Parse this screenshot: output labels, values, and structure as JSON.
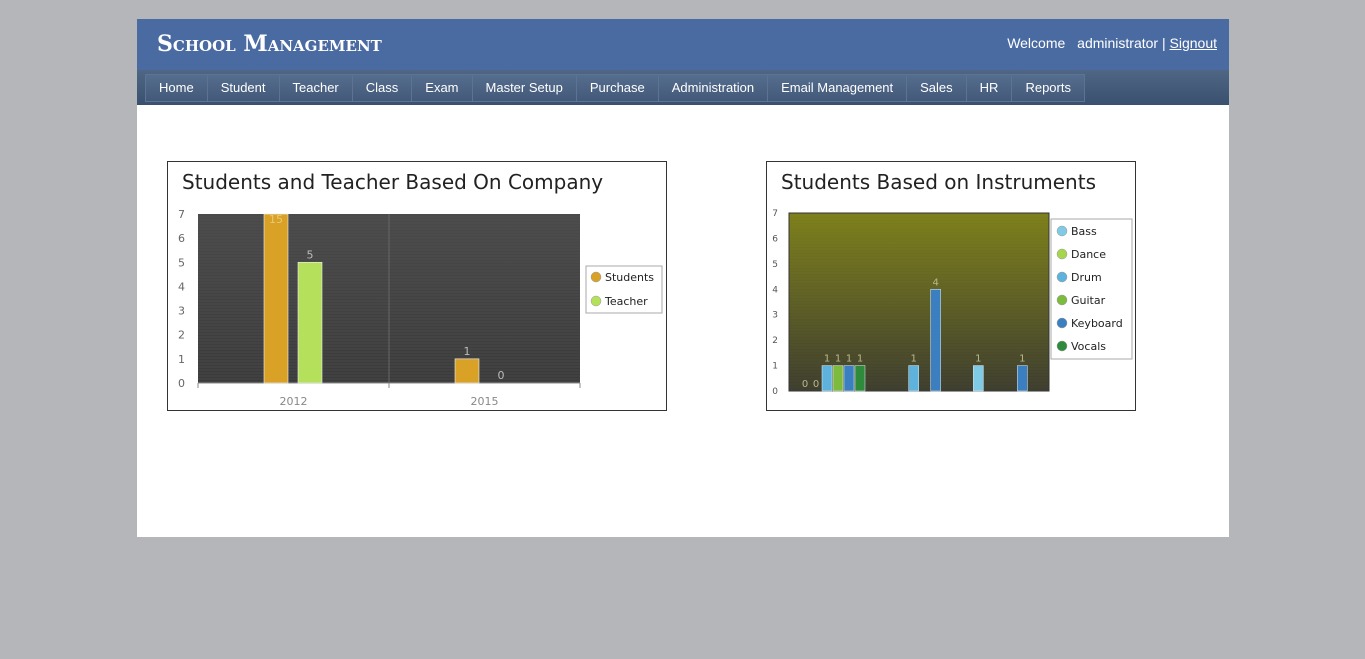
{
  "header": {
    "brand": "School Management",
    "welcome": "Welcome",
    "username": "administrator |",
    "signout": "Signout"
  },
  "nav": [
    "Home",
    "Student",
    "Teacher",
    "Class",
    "Exam",
    "Master Setup",
    "Purchase",
    "Administration",
    "Email Management",
    "Sales",
    "HR",
    "Reports"
  ],
  "chart_data": [
    {
      "type": "bar",
      "title": "Students and Teacher Based On Company",
      "categories": [
        "2012",
        "2015"
      ],
      "series": [
        {
          "name": "Students",
          "values": [
            15,
            1
          ],
          "color": "#d9a227"
        },
        {
          "name": "Teacher",
          "values": [
            5,
            0
          ],
          "color": "#b5e05c"
        }
      ],
      "ylim": [
        0,
        7
      ],
      "yticks": [
        0,
        1,
        2,
        3,
        4,
        5,
        6,
        7
      ],
      "legend": "right"
    },
    {
      "type": "bar",
      "title": "Students Based on Instruments",
      "categories": [
        "",
        "",
        ""
      ],
      "series": [
        {
          "name": "Bass",
          "values": [
            0,
            0,
            1
          ],
          "color": "#7fcbe6"
        },
        {
          "name": "Dance",
          "values": [
            0,
            0,
            0
          ],
          "color": "#a6d64e"
        },
        {
          "name": "Drum",
          "values": [
            1,
            1,
            0
          ],
          "color": "#5fb2dc"
        },
        {
          "name": "Guitar",
          "values": [
            1,
            0,
            0
          ],
          "color": "#7cbb3e"
        },
        {
          "name": "Keyboard",
          "values": [
            1,
            4,
            1
          ],
          "color": "#3c7fc1"
        },
        {
          "name": "Vocals",
          "values": [
            1,
            0,
            0
          ],
          "color": "#2e8b3c"
        }
      ],
      "ylim": [
        0,
        7
      ],
      "yticks": [
        0,
        1,
        2,
        3,
        4,
        5,
        6,
        7
      ],
      "legend": "right"
    }
  ]
}
